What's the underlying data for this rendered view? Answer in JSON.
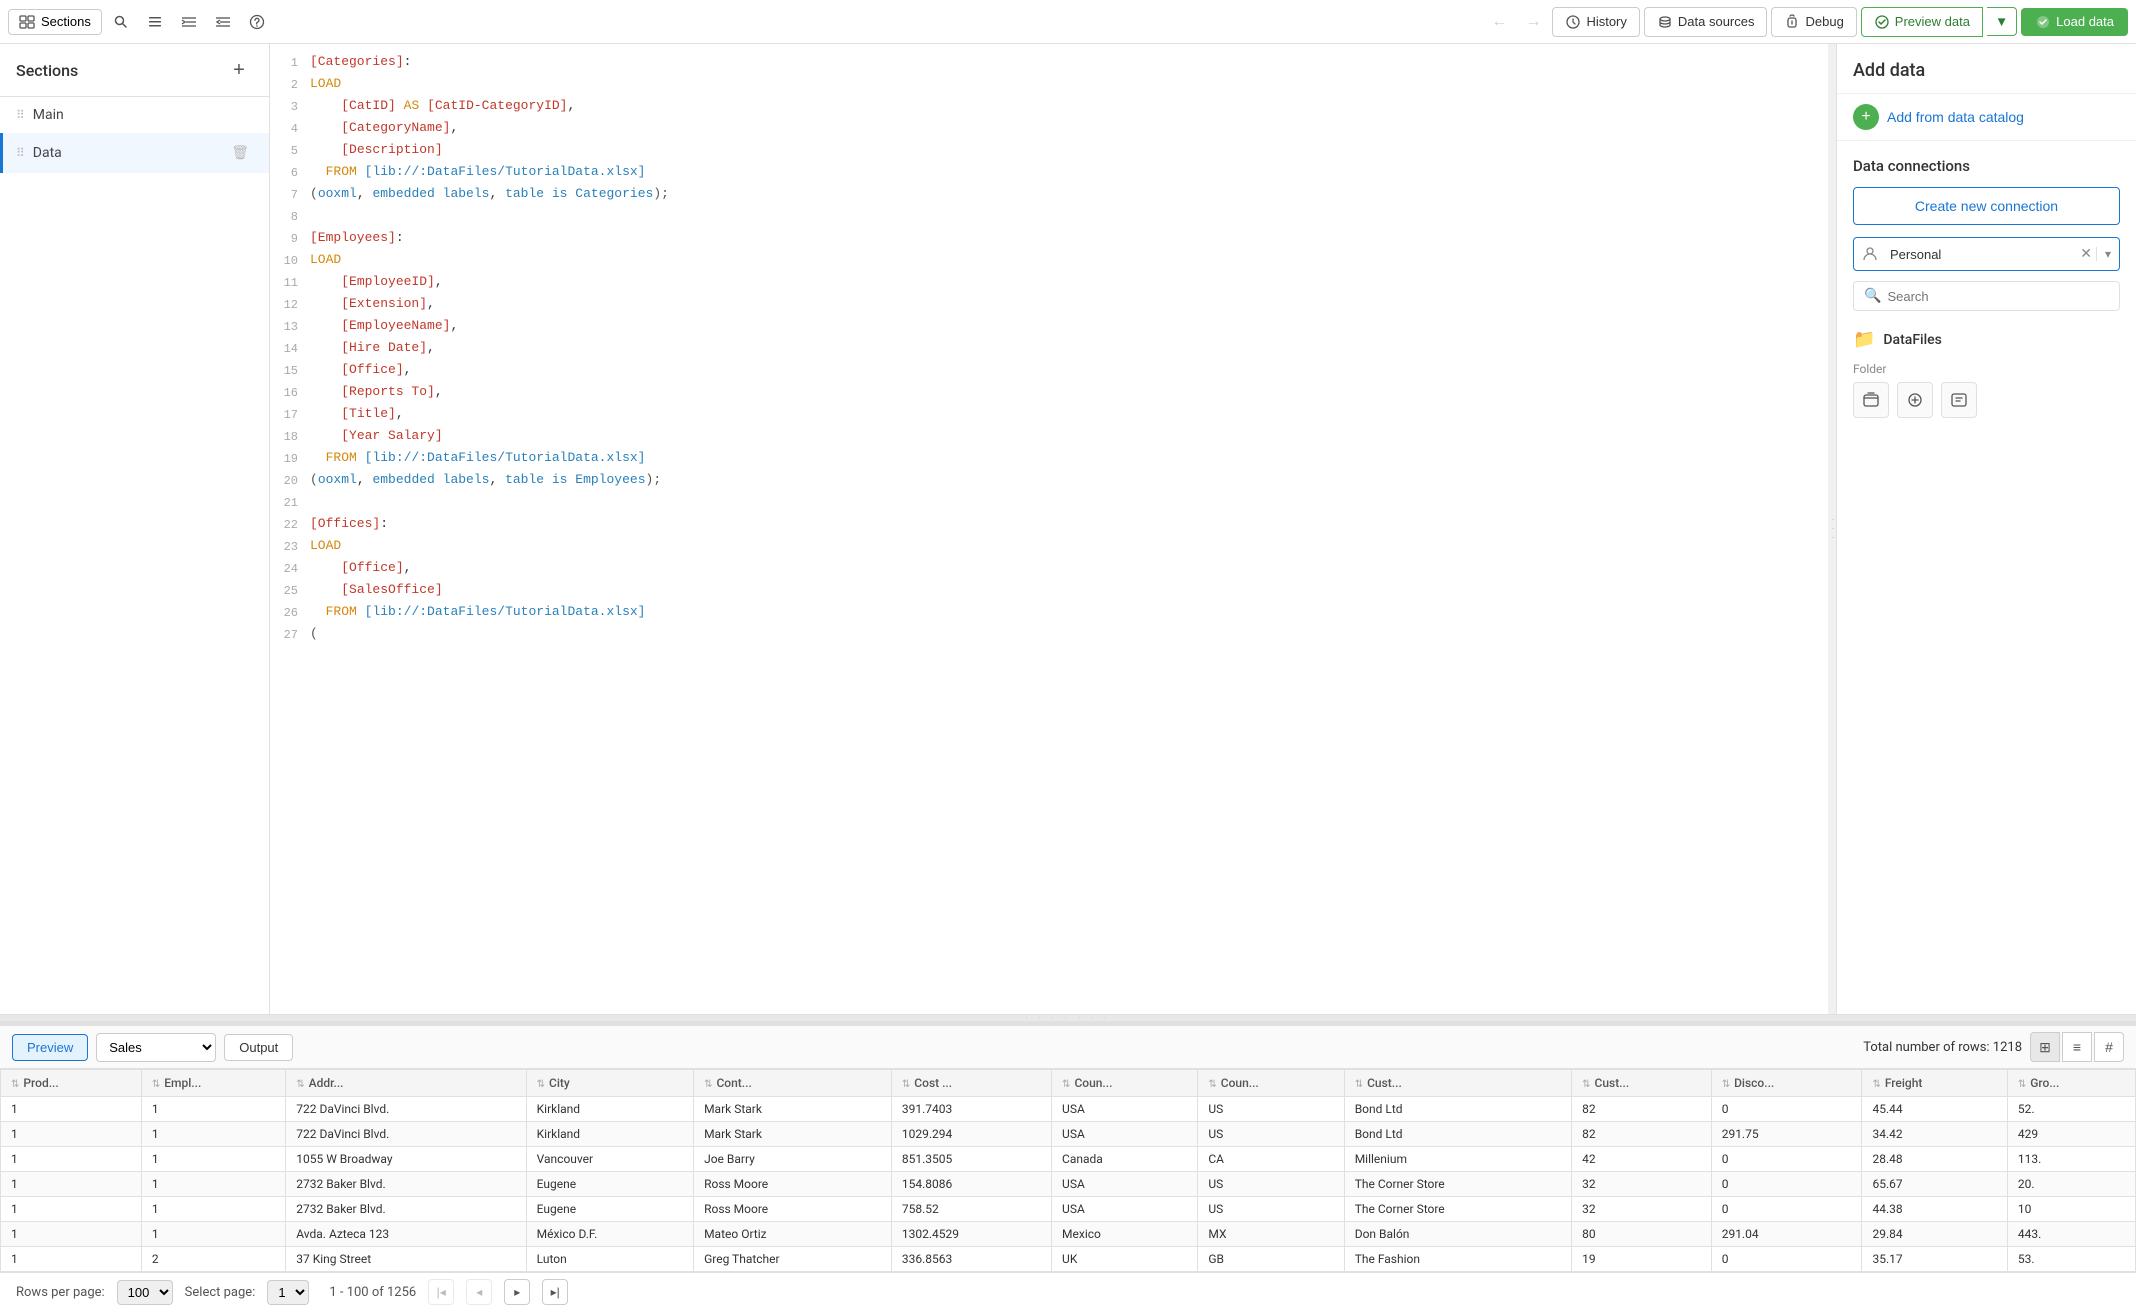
{
  "toolbar": {
    "sections_label": "Sections",
    "history_label": "History",
    "data_sources_label": "Data sources",
    "debug_label": "Debug",
    "preview_data_label": "Preview data",
    "load_data_label": "Load data"
  },
  "sidebar": {
    "title": "Sections",
    "add_label": "+",
    "items": [
      {
        "id": "main",
        "label": "Main",
        "active": false
      },
      {
        "id": "data",
        "label": "Data",
        "active": true
      }
    ]
  },
  "right_panel": {
    "title": "Add data",
    "add_catalog_label": "Add from data catalog",
    "data_connections_title": "Data connections",
    "create_connection_label": "Create new connection",
    "personal_value": "Personal",
    "search_placeholder": "Search",
    "datafiles_label": "DataFiles",
    "folder_type_label": "Folder"
  },
  "code_lines": [
    {
      "num": 1,
      "text": "[Categories]:"
    },
    {
      "num": 2,
      "text": "LOAD"
    },
    {
      "num": 3,
      "text": "    [CatID] AS [CatID-CategoryID],"
    },
    {
      "num": 4,
      "text": "    [CategoryName],"
    },
    {
      "num": 5,
      "text": "    [Description]"
    },
    {
      "num": 6,
      "text": "  FROM [lib://:DataFiles/TutorialData.xlsx]"
    },
    {
      "num": 7,
      "text": "(ooxml, embedded labels, table is Categories);"
    },
    {
      "num": 8,
      "text": ""
    },
    {
      "num": 9,
      "text": "[Employees]:"
    },
    {
      "num": 10,
      "text": "LOAD"
    },
    {
      "num": 11,
      "text": "    [EmployeeID],"
    },
    {
      "num": 12,
      "text": "    [Extension],"
    },
    {
      "num": 13,
      "text": "    [EmployeeName],"
    },
    {
      "num": 14,
      "text": "    [Hire Date],"
    },
    {
      "num": 15,
      "text": "    [Office],"
    },
    {
      "num": 16,
      "text": "    [Reports To],"
    },
    {
      "num": 17,
      "text": "    [Title],"
    },
    {
      "num": 18,
      "text": "    [Year Salary]"
    },
    {
      "num": 19,
      "text": "  FROM [lib://:DataFiles/TutorialData.xlsx]"
    },
    {
      "num": 20,
      "text": "(ooxml, embedded labels, table is Employees);"
    },
    {
      "num": 21,
      "text": ""
    },
    {
      "num": 22,
      "text": "[Offices]:"
    },
    {
      "num": 23,
      "text": "LOAD"
    },
    {
      "num": 24,
      "text": "    [Office],"
    },
    {
      "num": 25,
      "text": "    [SalesOffice]"
    },
    {
      "num": 26,
      "text": "  FROM [lib://:DataFiles/TutorialData.xlsx]"
    },
    {
      "num": 27,
      "text": "("
    }
  ],
  "bottom": {
    "preview_label": "Preview",
    "dataset_value": "Sales",
    "output_label": "Output",
    "total_rows_label": "Total number of rows: 1218",
    "rows_per_page_label": "Rows per page:",
    "rows_per_page_value": "100",
    "select_page_label": "Select page:",
    "page_value": "1",
    "page_info": "1 - 100 of 1256"
  },
  "table": {
    "columns": [
      "Prod...",
      "Empl...",
      "Addr...",
      "City",
      "Cont...",
      "Cost ...",
      "Coun...",
      "Coun...",
      "Cust...",
      "Cust...",
      "Disco...",
      "Freight",
      "Gro..."
    ],
    "rows": [
      [
        1,
        1,
        "722 DaVinci Blvd.",
        "Kirkland",
        "Mark Stark",
        "391.7403",
        "USA",
        "US",
        "Bond Ltd",
        82,
        0,
        "45.44",
        "52."
      ],
      [
        1,
        1,
        "722 DaVinci Blvd.",
        "Kirkland",
        "Mark Stark",
        "1029.294",
        "USA",
        "US",
        "Bond Ltd",
        82,
        "291.75",
        "34.42",
        "429"
      ],
      [
        1,
        1,
        "1055 W Broadway",
        "Vancouver",
        "Joe Barry",
        "851.3505",
        "Canada",
        "CA",
        "Millenium",
        42,
        0,
        "28.48",
        "113."
      ],
      [
        1,
        1,
        "2732 Baker Blvd.",
        "Eugene",
        "Ross Moore",
        "154.8086",
        "USA",
        "US",
        "The Corner Store",
        32,
        0,
        "65.67",
        "20."
      ],
      [
        1,
        1,
        "2732 Baker Blvd.",
        "Eugene",
        "Ross Moore",
        "758.52",
        "USA",
        "US",
        "The Corner Store",
        32,
        0,
        "44.38",
        "10"
      ],
      [
        1,
        1,
        "Avda. Azteca 123",
        "México D.F.",
        "Mateo Ortiz",
        "1302.4529",
        "Mexico",
        "MX",
        "Don Balón",
        80,
        "291.04",
        "29.84",
        "443."
      ],
      [
        1,
        2,
        "37 King Street",
        "Luton",
        "Greg Thatcher",
        "336.8563",
        "UK",
        "GB",
        "The Fashion",
        19,
        0,
        "35.17",
        "53."
      ]
    ]
  }
}
